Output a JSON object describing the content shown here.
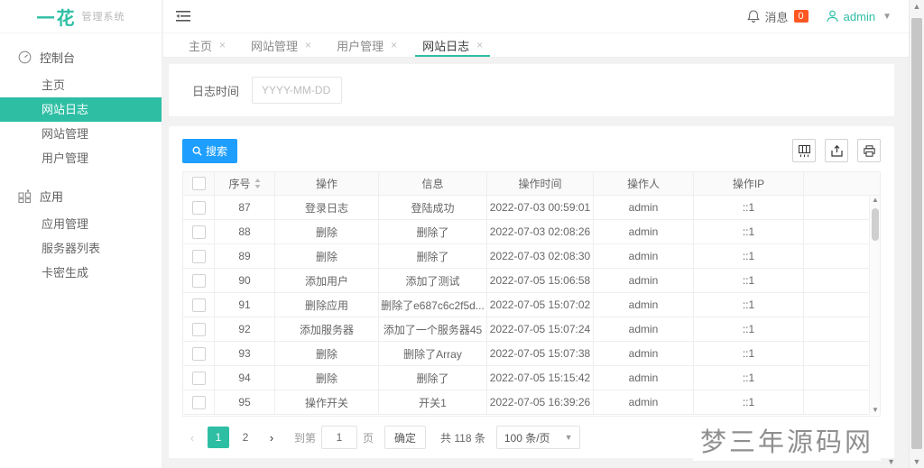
{
  "colors": {
    "accent": "#2ebea4",
    "blue": "#1e9fff",
    "badge": "#ff5722"
  },
  "logo": {
    "title": "一花",
    "subtitle": "管理系统"
  },
  "header": {
    "messages_label": "消息",
    "messages_badge": "0",
    "username": "admin"
  },
  "sidebar": {
    "groups": [
      {
        "icon": "dashboard-icon",
        "label": "控制台",
        "items": [
          {
            "label": "主页"
          },
          {
            "label": "网站日志",
            "active": true
          },
          {
            "label": "网站管理"
          },
          {
            "label": "用户管理"
          }
        ]
      },
      {
        "icon": "apps-icon",
        "label": "应用",
        "items": [
          {
            "label": "应用管理"
          },
          {
            "label": "服务器列表"
          },
          {
            "label": "卡密生成"
          }
        ]
      }
    ]
  },
  "tabs": {
    "items": [
      {
        "label": "主页"
      },
      {
        "label": "网站管理"
      },
      {
        "label": "用户管理"
      },
      {
        "label": "网站日志",
        "active": true
      }
    ]
  },
  "filter": {
    "label": "日志时间",
    "date_placeholder": "YYYY-MM-DD",
    "date_value": ""
  },
  "toolbar": {
    "search_label": "搜索",
    "icons": [
      "filter-columns-icon",
      "export-icon",
      "print-icon"
    ]
  },
  "table": {
    "columns": [
      {
        "label": "序号",
        "sortable": true
      },
      {
        "label": "操作"
      },
      {
        "label": "信息"
      },
      {
        "label": "操作时间"
      },
      {
        "label": "操作人"
      },
      {
        "label": "操作IP"
      }
    ],
    "rows": [
      [
        "87",
        "登录日志",
        "登陆成功",
        "2022-07-03 00:59:01",
        "admin",
        "::1"
      ],
      [
        "88",
        "删除",
        "删除了",
        "2022-07-03 02:08:26",
        "admin",
        "::1"
      ],
      [
        "89",
        "删除",
        "删除了",
        "2022-07-03 02:08:30",
        "admin",
        "::1"
      ],
      [
        "90",
        "添加用户",
        "添加了测试",
        "2022-07-05 15:06:58",
        "admin",
        "::1"
      ],
      [
        "91",
        "删除应用",
        "删除了e687c6c2f5d...",
        "2022-07-05 15:07:02",
        "admin",
        "::1"
      ],
      [
        "92",
        "添加服务器",
        "添加了一个服务器45",
        "2022-07-05 15:07:24",
        "admin",
        "::1"
      ],
      [
        "93",
        "删除",
        "删除了Array",
        "2022-07-05 15:07:38",
        "admin",
        "::1"
      ],
      [
        "94",
        "删除",
        "删除了",
        "2022-07-05 15:15:42",
        "admin",
        "::1"
      ],
      [
        "95",
        "操作开关",
        "开关1",
        "2022-07-05 16:39:26",
        "admin",
        "::1"
      ]
    ]
  },
  "pagination": {
    "pages": [
      "1",
      "2"
    ],
    "active_page": "1",
    "goto_label": "到第",
    "goto_value": "1",
    "goto_unit": "页",
    "confirm_label": "确定",
    "total_text": "共 118 条",
    "page_size_value": "100 条/页"
  },
  "watermark": {
    "text": "梦三年源码网"
  }
}
